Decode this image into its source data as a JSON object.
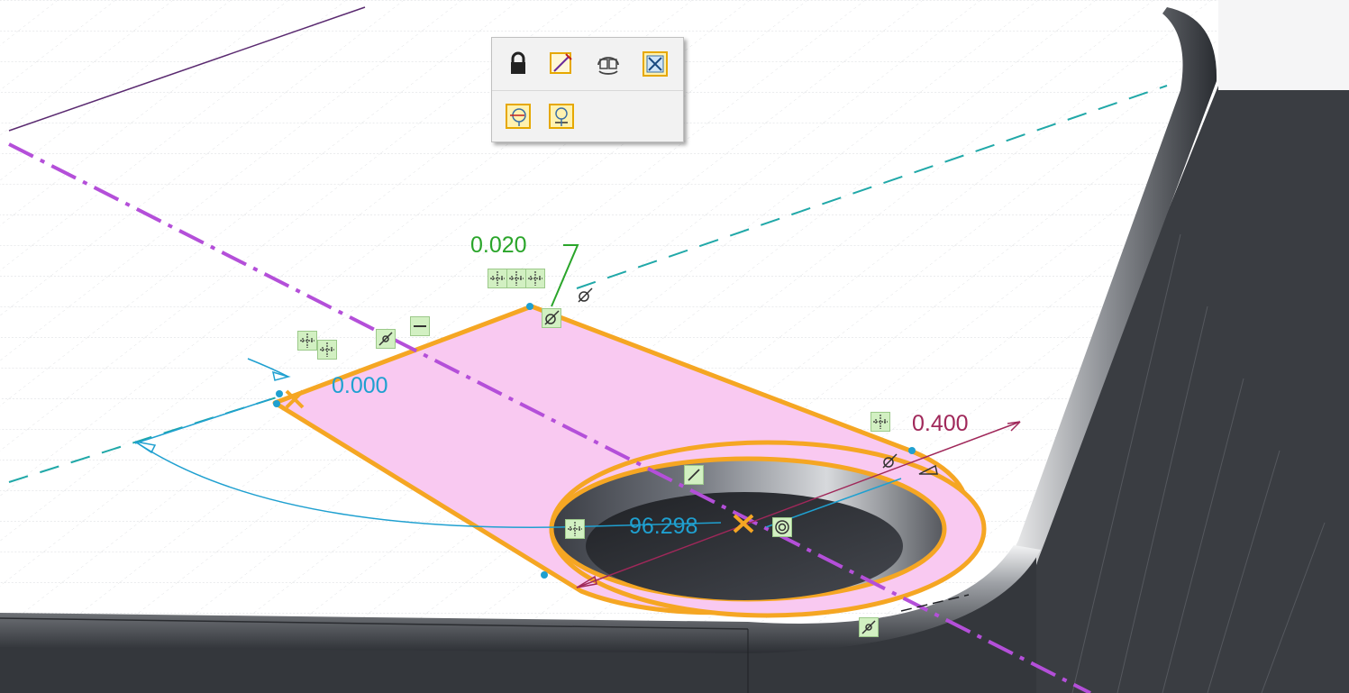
{
  "toolbar": {
    "tooltips": {
      "lock": "Lock",
      "sketch_view": "Sketch view",
      "flip": "Flip",
      "display_toggle": "Display",
      "reference_1": "Reference",
      "reference_2": "Reference"
    }
  },
  "dimensions": {
    "top_offset": "0.020",
    "left_offset": "0.000",
    "radius": "0.400",
    "angle": "96.298"
  },
  "colors": {
    "sketch_outline": "#f5a623",
    "sketch_fill": "#f9c9f1",
    "centerline": "#b44fd9",
    "reference_dash": "#20a8a8",
    "dimension_blue": "#1fa0d0",
    "dimension_green": "#2aa52a",
    "dimension_maroon": "#a0285a",
    "constraint_badge": "#d2f0c2",
    "solid_dark": "#3a3d42"
  },
  "icons": [
    "lock-icon",
    "sketch-view-icon",
    "flip-icon",
    "display-toggle-icon",
    "reference-icon",
    "reference-alt-icon",
    "horizontal-constraint-icon",
    "tangent-constraint-icon",
    "coincident-constraint-icon",
    "parallel-constraint-icon",
    "concentric-constraint-icon",
    "point-on-entity-icon",
    "symmetric-constraint-icon"
  ]
}
